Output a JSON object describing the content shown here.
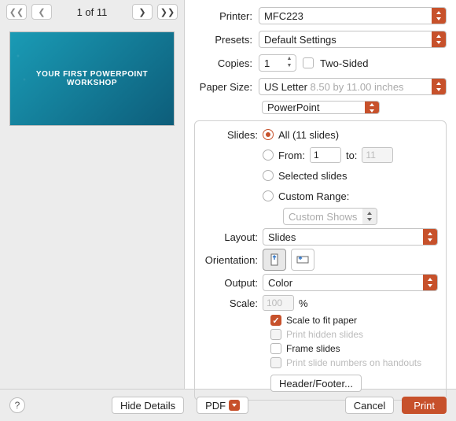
{
  "nav": {
    "page_label": "1 of 11"
  },
  "thumb": {
    "title": "YOUR FIRST POWERPOINT WORKSHOP"
  },
  "labels": {
    "printer": "Printer:",
    "presets": "Presets:",
    "copies": "Copies:",
    "two_sided": "Two-Sided",
    "paper_size": "Paper Size:",
    "slides": "Slides:",
    "from": "From:",
    "to": "to:",
    "layout": "Layout:",
    "orientation": "Orientation:",
    "output": "Output:",
    "scale": "Scale:",
    "percent": "%"
  },
  "values": {
    "printer": "MFC223",
    "presets": "Default Settings",
    "copies": "1",
    "paper_size": "US Letter",
    "paper_dims": "8.50 by 11.00 inches",
    "app": "PowerPoint",
    "all": "All  (11 slides)",
    "from_v": "1",
    "to_v": "11",
    "selected": "Selected slides",
    "custom_range": "Custom Range:",
    "custom_shows": "Custom Shows",
    "layout": "Slides",
    "output": "Color",
    "scale": "100",
    "scale_fit": "Scale to fit paper",
    "print_hidden": "Print hidden slides",
    "frame": "Frame slides",
    "print_nums": "Print slide numbers on handouts",
    "header_footer": "Header/Footer..."
  },
  "buttons": {
    "hide_details": "Hide Details",
    "pdf": "PDF",
    "cancel": "Cancel",
    "print": "Print",
    "help": "?"
  }
}
